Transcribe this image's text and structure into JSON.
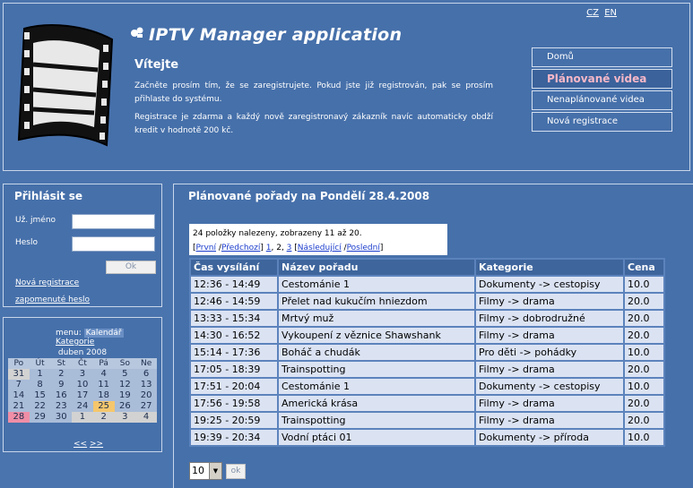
{
  "header": {
    "lang": [
      "CZ",
      "EN"
    ],
    "app_title": "IPTV Manager application",
    "welcome": "Vítejte",
    "intro1": "Začněte prosím tím, že se zaregistrujete. Pokud jste již registrován, pak se prosím přihlaste do systému.",
    "intro2": "Registrace je zdarma a každý nově zaregistronavý zákazník navíc automaticky obdží kredit v hodnotě 200 kč.",
    "nav": [
      {
        "label": "Domů",
        "active": false
      },
      {
        "label": "Plánované videa",
        "active": true
      },
      {
        "label": "Nenaplánované videa",
        "active": false
      },
      {
        "label": "Nová registrace",
        "active": false
      }
    ]
  },
  "login": {
    "title": "Přihlásit se",
    "user_label": "Už. jméno",
    "pass_label": "Heslo",
    "ok_label": "Ok",
    "register_link": "Nová registrace",
    "forgot_link": "zapomenuté heslo"
  },
  "calendar": {
    "menu_label": "menu:",
    "menu_items": [
      "Kalendář",
      "Kategorie"
    ],
    "month": "duben 2008",
    "weekdays": [
      "Po",
      "Út",
      "St",
      "Čt",
      "Pá",
      "So",
      "Ne"
    ],
    "weeks": [
      [
        {
          "d": "31",
          "t": "out"
        },
        {
          "d": "1",
          "t": "in"
        },
        {
          "d": "2",
          "t": "in"
        },
        {
          "d": "3",
          "t": "in"
        },
        {
          "d": "4",
          "t": "in"
        },
        {
          "d": "5",
          "t": "in"
        },
        {
          "d": "6",
          "t": "in"
        }
      ],
      [
        {
          "d": "7",
          "t": "in"
        },
        {
          "d": "8",
          "t": "in"
        },
        {
          "d": "9",
          "t": "in"
        },
        {
          "d": "10",
          "t": "in"
        },
        {
          "d": "11",
          "t": "in"
        },
        {
          "d": "12",
          "t": "in"
        },
        {
          "d": "13",
          "t": "in"
        }
      ],
      [
        {
          "d": "14",
          "t": "in"
        },
        {
          "d": "15",
          "t": "in"
        },
        {
          "d": "16",
          "t": "in"
        },
        {
          "d": "17",
          "t": "in"
        },
        {
          "d": "18",
          "t": "in"
        },
        {
          "d": "19",
          "t": "in"
        },
        {
          "d": "20",
          "t": "in"
        }
      ],
      [
        {
          "d": "21",
          "t": "in"
        },
        {
          "d": "22",
          "t": "in"
        },
        {
          "d": "23",
          "t": "in"
        },
        {
          "d": "24",
          "t": "in"
        },
        {
          "d": "25",
          "t": "today"
        },
        {
          "d": "26",
          "t": "in"
        },
        {
          "d": "27",
          "t": "in"
        }
      ],
      [
        {
          "d": "28",
          "t": "sel"
        },
        {
          "d": "29",
          "t": "in"
        },
        {
          "d": "30",
          "t": "in"
        },
        {
          "d": "1",
          "t": "out"
        },
        {
          "d": "2",
          "t": "out"
        },
        {
          "d": "3",
          "t": "out"
        },
        {
          "d": "4",
          "t": "out"
        }
      ]
    ],
    "nav_prev": "<<",
    "nav_next": ">>"
  },
  "main": {
    "title": "Plánované pořady na Pondělí 28.4.2008",
    "pager_summary": "24 položky nalezeny, zobrazeny 11 až 20.",
    "pager_links": {
      "open": "[",
      "first": "První",
      "sep": "/",
      "prev": "Předchozí",
      "close_sep": "]",
      "p1": "1",
      "p2": "2",
      "p3": "3",
      "next": "Následující",
      "last": "Poslední"
    },
    "columns": [
      "Čas vysílání",
      "Název pořadu",
      "Kategorie",
      "Cena"
    ],
    "rows": [
      [
        "12:36 - 14:49",
        "Cestománie 1",
        "Dokumenty -> cestopisy",
        "10.0"
      ],
      [
        "12:46 - 14:59",
        "Přelet nad kukučím hniezdom",
        "Filmy -> drama",
        "20.0"
      ],
      [
        "13:33 - 15:34",
        "Mrtvý muž",
        "Filmy -> dobrodružné",
        "20.0"
      ],
      [
        "14:30 - 16:52",
        "Vykoupení z věznice Shawshank",
        "Filmy -> drama",
        "20.0"
      ],
      [
        "15:14 - 17:36",
        "Boháč a chudák",
        "Pro děti -> pohádky",
        "10.0"
      ],
      [
        "17:05 - 18:39",
        "Trainspotting",
        "Filmy -> drama",
        "20.0"
      ],
      [
        "17:51 - 20:04",
        "Cestománie 1",
        "Dokumenty -> cestopisy",
        "10.0"
      ],
      [
        "17:56 - 19:58",
        "Americká krása",
        "Filmy -> drama",
        "20.0"
      ],
      [
        "19:25 - 20:59",
        "Trainspotting",
        "Filmy -> drama",
        "20.0"
      ],
      [
        "19:39 - 20:34",
        "Vodní ptáci 01",
        "Dokumenty -> příroda",
        "10.0"
      ]
    ],
    "page_size": "10",
    "page_size_ok": "ok"
  }
}
